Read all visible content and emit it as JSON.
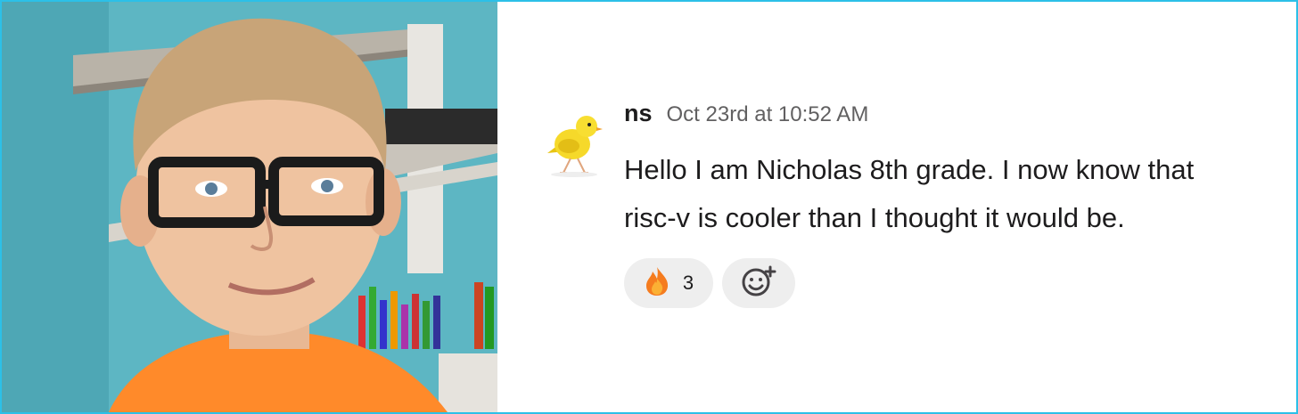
{
  "photo": {
    "kind": "profile-photo-illustration"
  },
  "message": {
    "username": "ns",
    "timestamp": "Oct 23rd at 10:52 AM",
    "text": "Hello I am Nicholas 8th grade. I now know that risc-v is cooler than I thought it would be.",
    "avatar_icon": "canary-bird-icon",
    "reactions": [
      {
        "icon": "fire-emoji-icon",
        "count": "3"
      }
    ],
    "add_reaction_icon": "add-reaction-icon"
  },
  "colors": {
    "border": "#2cc0e8",
    "pill": "#eeeeee",
    "text": "#1d1c1d",
    "muted": "#616061"
  }
}
